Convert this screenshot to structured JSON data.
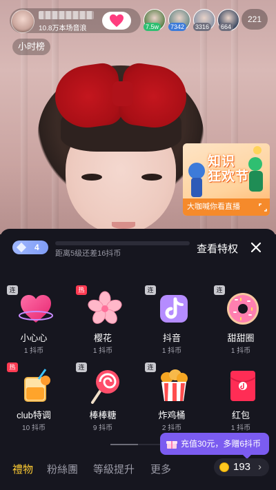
{
  "header": {
    "host_subtitle": "10.8万本场音浪",
    "online_count": "221",
    "hour_rank_label": "小时榜",
    "viewers": [
      {
        "badge": "7.5w",
        "badge_color": "#2fbf71",
        "bg": "#5a7f4a"
      },
      {
        "badge": "7342",
        "badge_color": "#3d7bd9",
        "bg": "#6d8c8a"
      },
      {
        "badge": "3316",
        "badge_color": "#6f6f7d",
        "bg": "#8a94a6"
      },
      {
        "badge": "664",
        "badge_color": "#6f6f7d",
        "bg": "#3d4a62"
      }
    ]
  },
  "promo": {
    "title_line1": "知识",
    "title_line2": "狂欢节",
    "footer": "大咖喊你看直播"
  },
  "panel": {
    "level": "4",
    "progress_text": "距离5级还差16抖币",
    "progress_fraction": 0.0,
    "privilege_label": "查看特权",
    "gifts": [
      {
        "name": "小心心",
        "price": "1 抖币",
        "tag": "连",
        "tag_type": "lian",
        "icon": "heart-gift-icon"
      },
      {
        "name": "樱花",
        "price": "1 抖币",
        "tag": "热",
        "tag_type": "hot",
        "icon": "sakura-gift-icon"
      },
      {
        "name": "抖音",
        "price": "1 抖币",
        "tag": "连",
        "tag_type": "lian",
        "icon": "douyin-logo-gift-icon"
      },
      {
        "name": "甜甜圈",
        "price": "1 抖币",
        "tag": "连",
        "tag_type": "lian",
        "icon": "donut-gift-icon"
      },
      {
        "name": "club特调",
        "price": "10 抖币",
        "tag": "热",
        "tag_type": "hot",
        "icon": "cocktail-gift-icon"
      },
      {
        "name": "棒棒糖",
        "price": "9 抖币",
        "tag": "连",
        "tag_type": "lian",
        "icon": "lollipop-gift-icon"
      },
      {
        "name": "炸鸡桶",
        "price": "2 抖币",
        "tag": "连",
        "tag_type": "lian",
        "icon": "fried-chicken-gift-icon"
      },
      {
        "name": "红包",
        "price": "1 抖币",
        "tag": "",
        "tag_type": "",
        "icon": "red-envelope-gift-icon"
      }
    ],
    "tabs": [
      {
        "label": "禮物",
        "active": true
      },
      {
        "label": "粉絲團",
        "active": false
      },
      {
        "label": "等級提升",
        "active": false
      },
      {
        "label": "更多",
        "active": false
      }
    ],
    "recharge_tip": "充值30元，多赠6抖币",
    "coin_balance": "193"
  }
}
